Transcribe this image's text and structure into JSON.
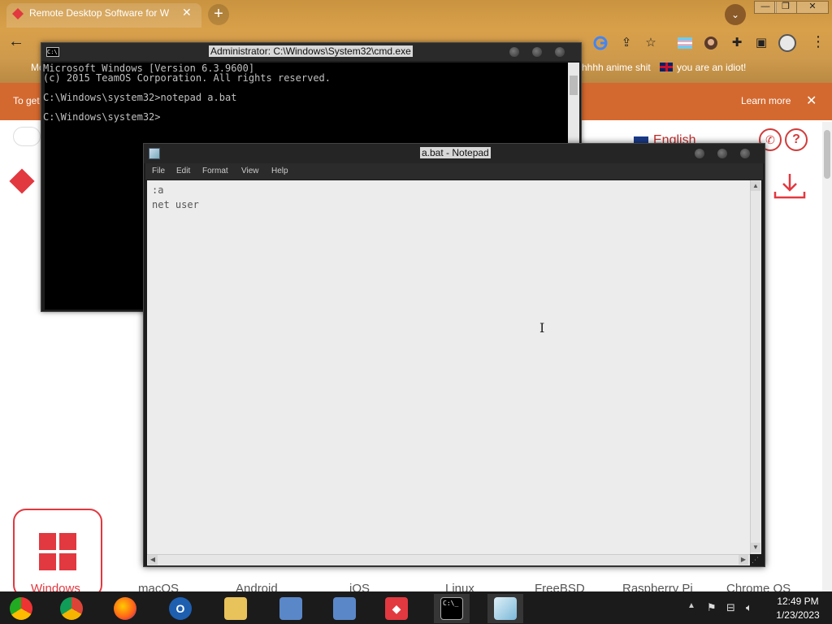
{
  "browser": {
    "tab_title": "Remote Desktop Software for W",
    "tab_close": "✕",
    "new_tab": "+",
    "window_controls": [
      "—",
      "❐",
      "✕"
    ],
    "back": "←",
    "bookmarks": [
      {
        "label": "Mo"
      },
      {
        "label": "hhhh anime shit"
      },
      {
        "label": "you are an idiot!"
      }
    ],
    "banner_text": "To get",
    "banner_learn_more": "Learn more",
    "banner_close": "✕",
    "menu": "⋮"
  },
  "webpage": {
    "language": "English",
    "os_labels": [
      "Windows",
      "macOS",
      "Android",
      "iOS",
      "Linux",
      "FreeBSD",
      "Raspberry Pi",
      "Chrome OS"
    ]
  },
  "cmd": {
    "title": "Administrator: C:\\Windows\\System32\\cmd.exe",
    "icon_text": "C:\\",
    "lines": [
      "Microsoft Windows [Version 6.3.9600]",
      "(c) 2015 TeamOS Corporation. All rights reserved.",
      "",
      "C:\\Windows\\system32>notepad a.bat",
      "",
      "C:\\Windows\\system32>"
    ]
  },
  "notepad": {
    "title": "a.bat - Notepad",
    "menu": [
      "File",
      "Edit",
      "Format",
      "View",
      "Help"
    ],
    "content_lines": [
      ":a",
      "net user"
    ]
  },
  "taskbar": {
    "cmd_glyph": "C:\\_",
    "time": "12:49 PM",
    "date": "1/23/2023"
  },
  "colors": {
    "anydesk_red": "#e2383f",
    "banner": "#d4692f",
    "chrome_frame": "#c9933f"
  }
}
